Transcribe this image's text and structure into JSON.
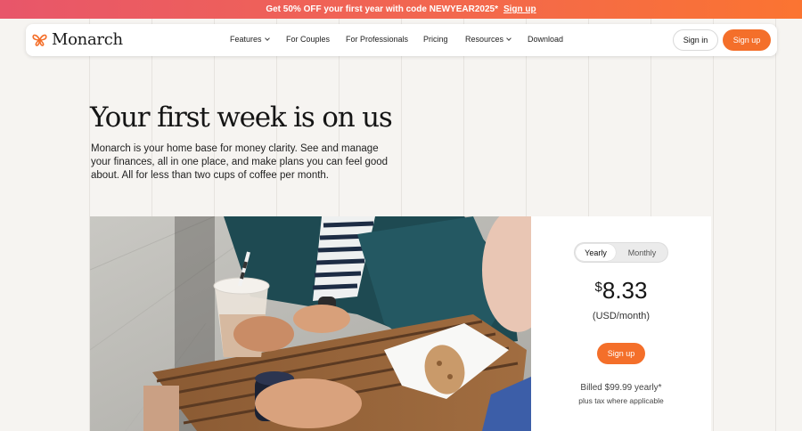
{
  "promo": {
    "text": "Get 50% OFF your first year with code NEWYEAR2025*",
    "link": "Sign up"
  },
  "nav": {
    "brand": "Monarch",
    "links": [
      "Features",
      "For Couples",
      "For Professionals",
      "Pricing",
      "Resources",
      "Download"
    ],
    "sign_in": "Sign in",
    "sign_up": "Sign up"
  },
  "hero": {
    "title": "Your first week is on us",
    "subtitle": "Monarch is your home base for money clarity. See and manage your finances, all in one place, and make plans you can feel good about. All for less than two cups of coffee per month."
  },
  "pricing": {
    "options": [
      "Yearly",
      "Monthly"
    ],
    "selected": "Yearly",
    "currency_symbol": "$",
    "amount": "8.33",
    "period": "(USD/month)",
    "cta": "Sign up",
    "billed": "Billed $99.99 yearly*",
    "tax_note": "plus tax where applicable"
  },
  "colors": {
    "accent": "#f46f2a",
    "promo_start": "#e8566a",
    "promo_end": "#fb7431"
  }
}
